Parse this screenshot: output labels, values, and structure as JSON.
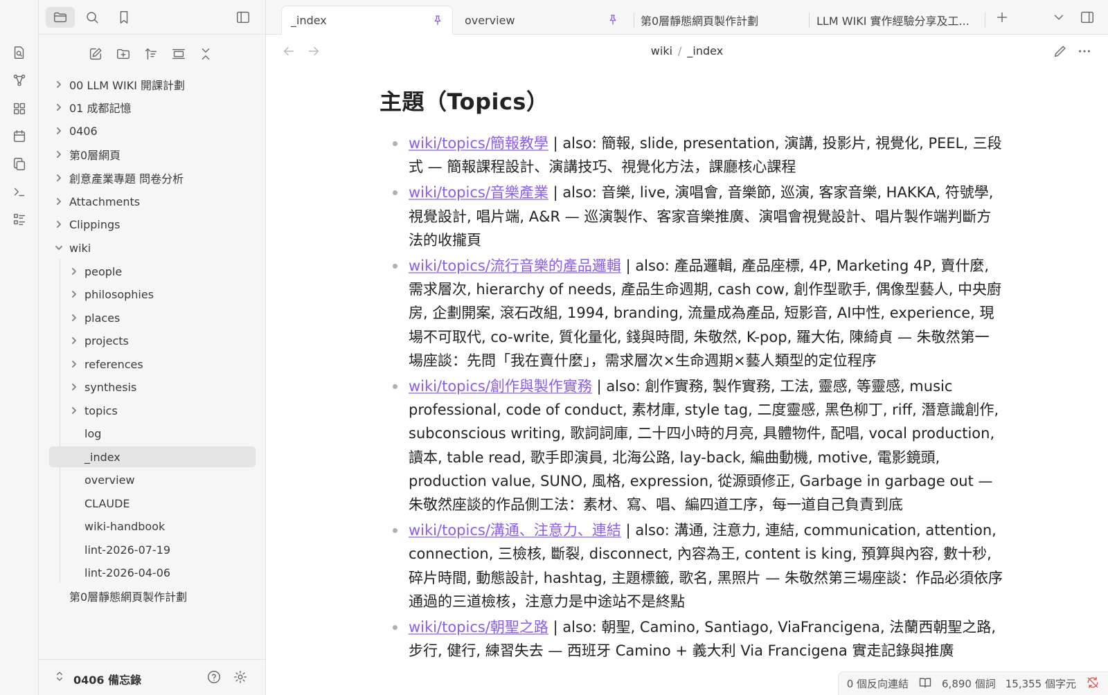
{
  "tabs": [
    {
      "label": "_index",
      "pinned": true,
      "active": true
    },
    {
      "label": "overview",
      "pinned": true,
      "active": false
    },
    {
      "label": "第0層靜態網頁製作計劃",
      "pinned": false,
      "active": false
    },
    {
      "label": "LLM WIKI 實作經驗分享及工...",
      "pinned": false,
      "active": false
    }
  ],
  "breadcrumb": {
    "parent": "wiki",
    "separator": "/",
    "current": "_index"
  },
  "page_title": "主題（Topics）",
  "tree": [
    {
      "label": "00 LLM WIKI 開課計劃",
      "type": "folder"
    },
    {
      "label": "01 成都記憶",
      "type": "folder"
    },
    {
      "label": "0406",
      "type": "folder"
    },
    {
      "label": "第0層網頁",
      "type": "folder"
    },
    {
      "label": "創意產業專題 問卷分析",
      "type": "folder"
    },
    {
      "label": "Attachments",
      "type": "folder"
    },
    {
      "label": "Clippings",
      "type": "folder"
    },
    {
      "label": "wiki",
      "type": "folder-open"
    },
    {
      "label": "people",
      "type": "folder"
    },
    {
      "label": "philosophies",
      "type": "folder"
    },
    {
      "label": "places",
      "type": "folder"
    },
    {
      "label": "projects",
      "type": "folder"
    },
    {
      "label": "references",
      "type": "folder"
    },
    {
      "label": "synthesis",
      "type": "folder"
    },
    {
      "label": "topics",
      "type": "folder"
    },
    {
      "label": "log",
      "type": "file"
    },
    {
      "label": "_index",
      "type": "file",
      "selected": true
    },
    {
      "label": "overview",
      "type": "file"
    },
    {
      "label": "CLAUDE",
      "type": "file"
    },
    {
      "label": "wiki-handbook",
      "type": "file"
    },
    {
      "label": "lint-2026-07-19",
      "type": "file"
    },
    {
      "label": "lint-2026-04-06",
      "type": "file"
    },
    {
      "label": "第0層靜態網頁製作計劃",
      "type": "file"
    }
  ],
  "vault_name": "0406 備忘錄",
  "topics": [
    {
      "link": "wiki/topics/簡報教學",
      "rest": " | also: 簡報, slide, presentation, 演講, 投影片, 視覺化, PEEL, 三段式 — 簡報課程設計、演講技巧、視覺化方法，課廳核心課程"
    },
    {
      "link": "wiki/topics/音樂產業",
      "rest": " | also: 音樂, live, 演唱會, 音樂節, 巡演, 客家音樂, HAKKA, 符號學, 視覺設計, 唱片端, A&R — 巡演製作、客家音樂推廣、演唱會視覺設計、唱片製作端判斷方法的收攏頁"
    },
    {
      "link": "wiki/topics/流行音樂的產品邏輯",
      "rest": " | also: 產品邏輯, 產品座標, 4P, Marketing 4P, 賣什麼, 需求層次, hierarchy of needs, 產品生命週期, cash cow, 創作型歌手, 偶像型藝人, 中央廚房, 企劃開案, 滾石改組, 1994, branding, 流量成為產品, 短影音, AI中性, experience, 現場不可取代, co-write, 質化量化, 錢與時間, 朱敬然, K-pop, 羅大佑, 陳綺貞 — 朱敬然第一場座談：先問「我在賣什麼」，需求層次×生命週期×藝人類型的定位程序"
    },
    {
      "link": "wiki/topics/創作與製作實務",
      "rest": " | also: 創作實務, 製作實務, 工法, 靈感, 等靈感, music professional, code of conduct, 素材庫, style tag, 二度靈感, 黑色柳丁, riff, 潛意識創作, subconscious writing, 歌詞詞庫, 二十四小時的月亮, 具體物件, 配唱, vocal production, 讀本, table read, 歌手即演員, 北海公路, lay-back, 編曲動機, motive, 電影鏡頭, production value, SUNO, 風格, expression, 從源頭修正, Garbage in garbage out — 朱敬然座談的作品側工法：素材、寫、唱、編四道工序，每一道自己負責到底"
    },
    {
      "link": "wiki/topics/溝通、注意力、連結",
      "rest": " | also: 溝通, 注意力, 連結, communication, attention, connection, 三檢核, 斷裂, disconnect, 內容為王, content is king, 預算與內容, 數十秒, 碎片時間, 動態設計, hashtag, 主題標籤, 歌名, 黑照片 — 朱敬然第三場座談：作品必須依序通過的三道檢核，注意力是中途站不是終點"
    },
    {
      "link": "wiki/topics/朝聖之路",
      "rest": " | also: 朝聖, Camino, Santiago, ViaFrancigena, 法蘭西朝聖之路, 步行, 健行, 練習失去 — 西班牙 Camino + 義大利 Via Francigena 實走記錄與推廣"
    }
  ],
  "status": {
    "backlinks": "0 個反向連結",
    "words": "6,890 個詞",
    "chars": "15,355 個字元"
  }
}
